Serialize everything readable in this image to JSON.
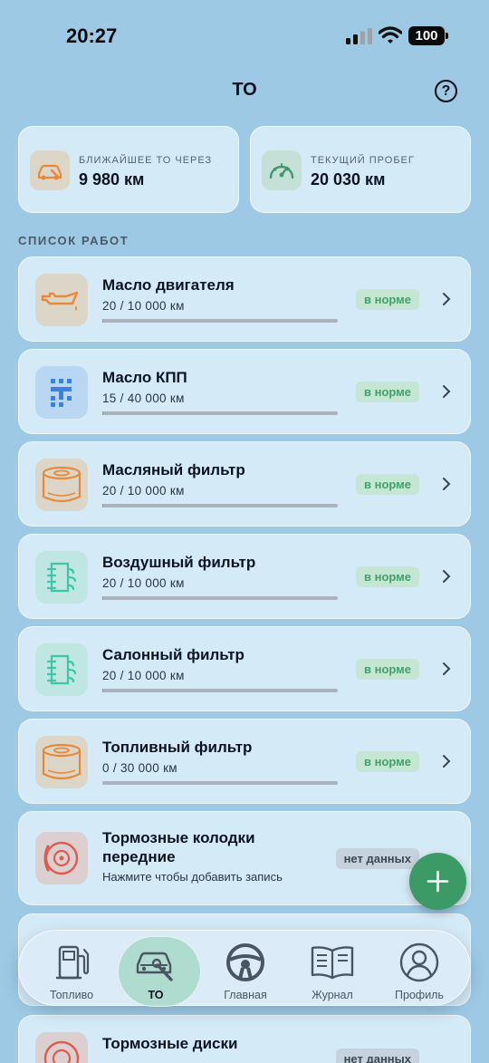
{
  "status_bar": {
    "time": "20:27",
    "battery": "100"
  },
  "header": {
    "title": "ТО",
    "help_icon": "question-circle-icon"
  },
  "summary": [
    {
      "label": "БЛИЖАЙШЕЕ ТО ЧЕРЕЗ",
      "value": "9 980 км",
      "icon": "car-service-icon",
      "color": "#e8893a"
    },
    {
      "label": "ТЕКУЩИЙ ПРОБЕГ",
      "value": "20 030 км",
      "icon": "speedometer-icon",
      "color": "#3e9a6c"
    }
  ],
  "section_title": "СПИСОК РАБОТ",
  "works": [
    {
      "name": "Масло двигателя",
      "progress": "20 / 10 000 км",
      "fraction": 0.002,
      "status": "в норме",
      "icon": "oil-can-icon"
    },
    {
      "name": "Масло КПП",
      "progress": "15 / 40 000 км",
      "fraction": 0.0004,
      "status": "в норме",
      "icon": "gearbox-icon"
    },
    {
      "name": "Масляный фильтр",
      "progress": "20 / 10 000 км",
      "fraction": 0.002,
      "status": "в норме",
      "icon": "oil-filter-icon"
    },
    {
      "name": "Воздушный фильтр",
      "progress": "20 / 10 000 км",
      "fraction": 0.002,
      "status": "в норме",
      "icon": "air-filter-icon"
    },
    {
      "name": "Салонный фильтр",
      "progress": "20 / 10 000 км",
      "fraction": 0.002,
      "status": "в норме",
      "icon": "cabin-filter-icon"
    },
    {
      "name": "Топливный фильтр",
      "progress": "0 / 30 000 км",
      "fraction": 0,
      "status": "в норме",
      "icon": "fuel-filter-icon"
    }
  ],
  "works_nodata": [
    {
      "name_line1": "Тормозные колодки",
      "name_line2": "передние",
      "hint": "Нажмите чтобы добавить запись",
      "status": "нет данных",
      "icon": "brake-pads-icon"
    },
    {
      "name": "Тормозные диски",
      "status": "нет данных",
      "icon": "brake-disc-icon"
    }
  ],
  "fab": {
    "icon": "plus-icon"
  },
  "nav": [
    {
      "label": "Топливо",
      "icon": "fuel-pump-icon"
    },
    {
      "label": "ТО",
      "icon": "car-wrench-icon",
      "active": true
    },
    {
      "label": "Главная",
      "icon": "steering-wheel-icon"
    },
    {
      "label": "Журнал",
      "icon": "book-icon"
    },
    {
      "label": "Профиль",
      "icon": "user-icon"
    }
  ],
  "colors": {
    "accent_green": "#3c9a66",
    "badge_ok_bg": "#c4e6d3",
    "badge_ok_text": "#43a06b",
    "background": "#9ec9e5"
  }
}
